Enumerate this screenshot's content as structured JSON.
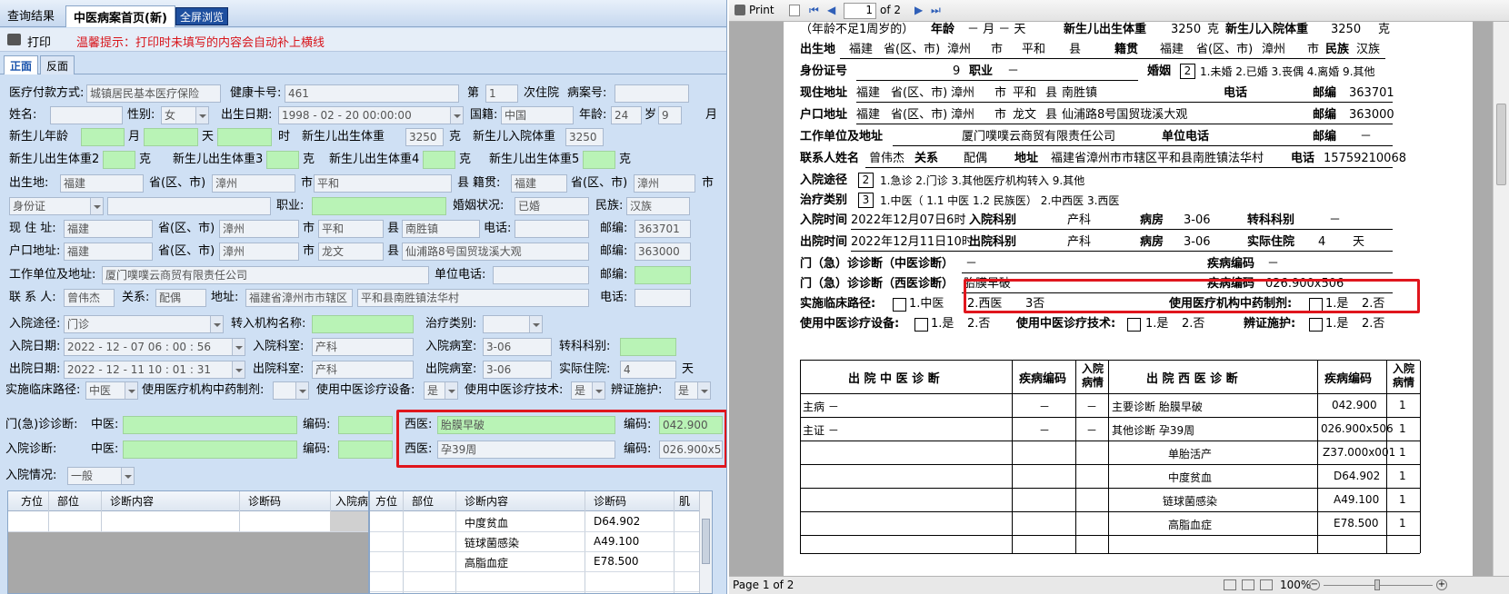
{
  "left_tabs": {
    "query": "查询结果",
    "active": "中医病案首页(新)",
    "fullscreen": "全屏浏览"
  },
  "toolbar": {
    "print": "打印",
    "warn": "温馨提示：打印时未填写的内容会自动补上横线"
  },
  "subtabs": {
    "front": "正面",
    "back": "反面"
  },
  "form": {
    "pay_label": "医疗付款方式:",
    "pay_val": "城镇居民基本医疗保险",
    "card_label": "健康卡号:",
    "card_val": "461",
    "di_label": "第",
    "di_val": "1",
    "ci_label": "次住院",
    "case_label": "病案号:",
    "name_label": "姓名:",
    "sex_label": "性别:",
    "sex_val": "女",
    "birth_label": "出生日期:",
    "birth_val": "1998 - 02 - 20   00:00:00",
    "nation_label": "国籍:",
    "nation_val": "中国",
    "age_label": "年龄:",
    "age_val": "24",
    "sui": "岁",
    "month_val": "9",
    "yue": "月",
    "nb_age_label": "新生儿年龄",
    "yue2": "月",
    "tian": "天",
    "shi": "时",
    "nb_bw_label": "新生儿出生体重",
    "nb_bw_val": "3250",
    "ke": "克",
    "nb_in_label": "新生儿入院体重",
    "nb_in_val": "3250",
    "nb_bw2": "新生儿出生体重2",
    "nb_bw3": "新生儿出生体重3",
    "nb_bw4": "新生儿出生体重4",
    "nb_bw5": "新生儿出生体重5",
    "birthplace_label": "出生地:",
    "prov_val": "福建",
    "prov_label": "省(区、市)",
    "city_val": "漳州",
    "shi_label": "市",
    "county_val": "平和",
    "xian_label": "县",
    "native_label": "籍贯:",
    "id_type": "身份证",
    "job_label": "职业:",
    "marry_label": "婚姻状况:",
    "marry_val": "已婚",
    "ethnic_label": "民族:",
    "ethnic_val": "汉族",
    "addr_label": "现 住 址:",
    "town_val": "南胜镇",
    "tel_label": "电话:",
    "post_label": "邮编:",
    "post1": "363701",
    "hukou_label": "户口地址:",
    "county2_val": "龙文",
    "street_val": "仙浦路8号国贸珑溪大观",
    "post2": "363000",
    "work_label": "工作单位及地址:",
    "work_val": "厦门噗噗云商贸有限责任公司",
    "worktel_label": "单位电话:",
    "post3_label": "邮编:",
    "contact_label": "联 系 人:",
    "contact_val": "曾伟杰",
    "rel_label": "关系:",
    "rel_val": "配偶",
    "caddr_label": "地址:",
    "caddr1": "福建省漳州市市辖区",
    "caddr2": "平和县南胜镇法华村",
    "ctel_label": "电话:",
    "route_label": "入院途径:",
    "route_val": "门诊",
    "transfer_label": "转入机构名称:",
    "treat_label": "治疗类别:",
    "in_date_label": "入院日期:",
    "in_date_val": "2022 - 12 - 07   06 : 00 : 56",
    "in_dept_label": "入院科室:",
    "in_dept_val": "产科",
    "in_ward_label": "入院病室:",
    "in_ward_val": "3-06",
    "tr_dept_label": "转科科别:",
    "out_date_label": "出院日期:",
    "out_date_val": "2022 - 12 - 11   10 : 01 : 31",
    "out_dept_label": "出院科室:",
    "out_ward_label": "出院病室:",
    "days_label": "实际住院:",
    "days_val": "4",
    "days_unit": "天",
    "path_label": "实施临床路径:",
    "path_val": "中医",
    "herb_label": "使用医疗机构中药制剂:",
    "equip_label": "使用中医诊疗设备:",
    "yes": "是",
    "tech_label": "使用中医诊疗技术:",
    "syndrome_label": "辨证施护:",
    "er_label": "门(急)诊诊断:",
    "tcm_label": "中医:",
    "code_label": "编码:",
    "west_label": "西医:",
    "er_west_val": "胎膜早破",
    "er_code_val": "042.900",
    "in_diag_label": "入院诊断:",
    "in_west_val": "孕39周",
    "in_code_val": "026.900x5(",
    "cond_label": "入院情况:",
    "cond_val": "一般"
  },
  "grid_left": {
    "headers": [
      "方位",
      "部位",
      "诊断内容",
      "诊断码",
      "入院病"
    ]
  },
  "grid_right": {
    "headers": [
      "方位",
      "部位",
      "诊断内容",
      "诊断码",
      "肌"
    ],
    "rows": [
      [
        "中度贫血",
        "D64.902"
      ],
      [
        "链球菌感染",
        "A49.100"
      ],
      [
        "高脂血症",
        "E78.500"
      ]
    ]
  },
  "viewer": {
    "print": "Print",
    "page_num": "1",
    "of": "of 2",
    "status": "Page 1 of 2",
    "zoom": "100%"
  },
  "doc": {
    "r0": {
      "age_note": "（年龄不足1周岁的）",
      "age": "年龄",
      "age_val": "－ 月 － 天",
      "nb_bw": "新生儿出生体重",
      "nb_bw_val": "3250",
      "ke": "克",
      "nb_in": "新生儿入院体重",
      "nb_in_val": "3250",
      "ke2": "克"
    },
    "r1": {
      "label": "出生地",
      "prov": "福建",
      "pl": "省(区、市)",
      "city": "漳州",
      "sl": "市",
      "county": "平和",
      "xl": "县",
      "jg": "籍贯",
      "jprov": "福建",
      "jpl": "省(区、市)",
      "jcity": "漳州",
      "jsl": "市",
      "mz": "民族",
      "mz_val": "汉族"
    },
    "r2": {
      "id": "身份证号",
      "id_tail": "9",
      "job": "职业",
      "job_val": "－",
      "marry": "婚姻",
      "marry_val": "2",
      "opts": "1.未婚 2.已婚 3.丧偶 4.离婚 9.其他"
    },
    "r3": {
      "label": "现住地址",
      "prov": "福建",
      "pl": "省(区、市)",
      "city": "漳州",
      "sl": "市",
      "county": "平和",
      "xl": "县",
      "town": "南胜镇",
      "tel": "电话",
      "post": "邮编",
      "post_val": "363701"
    },
    "r4": {
      "label": "户口地址",
      "prov": "福建",
      "pl": "省(区、市)",
      "city": "漳州",
      "sl": "市",
      "county": "龙文",
      "xl": "县",
      "street": "仙浦路8号国贸珑溪大观",
      "post": "邮编",
      "post_val": "363000"
    },
    "r5": {
      "label": "工作单位及地址",
      "val": "厦门噗噗云商贸有限责任公司",
      "tel": "单位电话",
      "post": "邮编",
      "post_val": "－"
    },
    "r6": {
      "label": "联系人姓名",
      "val": "曾伟杰",
      "rel": "关系",
      "rel_val": "配偶",
      "addr": "地址",
      "addr_val": "福建省漳州市市辖区平和县南胜镇法华村",
      "tel": "电话",
      "tel_val": "15759210068"
    },
    "r7": {
      "label": "入院途径",
      "val": "2",
      "opts": "1.急诊 2.门诊 3.其他医疗机构转入 9.其他"
    },
    "r8": {
      "label": "治疗类别",
      "val": "3",
      "opts": "1.中医（ 1.1 中医 1.2 民族医） 2.中西医 3.西医"
    },
    "r9": {
      "label": "入院时间",
      "val": "2022年12月07日6时",
      "dept": "入院科别",
      "dept_val": "产科",
      "ward": "病房",
      "ward_val": "3-06",
      "tr": "转科科别",
      "tr_val": "－"
    },
    "r10": {
      "label": "出院时间",
      "val": "2022年12月11日10时",
      "dept": "出院科别",
      "dept_val": "产科",
      "ward": "病房",
      "ward_val": "3-06",
      "days": "实际住院",
      "days_val": "4",
      "tian": "天"
    },
    "r11": {
      "label": "门（急）诊诊断（中医诊断）",
      "val": "－",
      "code": "疾病编码",
      "code_val": "－"
    },
    "r12": {
      "label": "门（急）诊诊断（西医诊断）",
      "val": "胎膜早破",
      "code": "疾病编码",
      "code_val": "026.900x506"
    },
    "r13": {
      "label": "实施临床路径:",
      "o1": "1.中医",
      "o2": "2.西医",
      "o3": "3否",
      "herb": "使用医疗机构中药制剂:",
      "y": "1.是",
      "n": "2.否"
    },
    "r14": {
      "equip": "使用中医诊疗设备:",
      "y": "1.是",
      "n": "2.否",
      "tech": "使用中医诊疗技术:",
      "syn": "辨证施护:"
    },
    "table": {
      "h": [
        "出 院 中 医 诊 断",
        "疾病编码",
        "入院病情",
        "出 院 西 医 诊 断",
        "疾病编码",
        "入院病情"
      ],
      "rows": [
        [
          "主病 －",
          "－",
          "－",
          "主要诊断 胎膜早破",
          "042.900",
          "1"
        ],
        [
          "主证 －",
          "－",
          "－",
          "其他诊断 孕39周",
          "026.900x506",
          "1"
        ],
        [
          "",
          "",
          "",
          "单胎活产",
          "Z37.000x001",
          "1"
        ],
        [
          "",
          "",
          "",
          "中度贫血",
          "D64.902",
          "1"
        ],
        [
          "",
          "",
          "",
          "链球菌感染",
          "A49.100",
          "1"
        ],
        [
          "",
          "",
          "",
          "高脂血症",
          "E78.500",
          "1"
        ]
      ]
    }
  },
  "colors": {
    "red_box": "#e0161d",
    "green_field": "#b9f3b6",
    "tab_blue": "#1e4f9f"
  }
}
